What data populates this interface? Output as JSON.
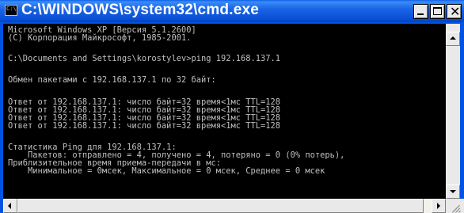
{
  "window": {
    "title": "C:\\WINDOWS\\system32\\cmd.exe",
    "icon": "cmd-icon",
    "icon_text": "C:\\"
  },
  "title_buttons": {
    "minimize_icon": "minimize-icon",
    "maximize_icon": "maximize-icon",
    "close_icon": "close-icon",
    "close_glyph": "✕"
  },
  "console": {
    "lines": [
      "Microsoft Windows XP [Версия 5.1.2600]",
      "(С) Корпорация Майкрософт, 1985-2001.",
      "",
      "C:\\Documents and Settings\\korostylev>ping 192.168.137.1",
      "",
      "Обмен пакетами с 192.168.137.1 по 32 байт:",
      "",
      "Ответ от 192.168.137.1: число байт=32 время<1мс TTL=128",
      "Ответ от 192.168.137.1: число байт=32 время<1мс TTL=128",
      "Ответ от 192.168.137.1: число байт=32 время<1мс TTL=128",
      "Ответ от 192.168.137.1: число байт=32 время<1мс TTL=128",
      "",
      "Статистика Ping для 192.168.137.1:",
      "    Пакетов: отправлено = 4, получено = 4, потеряно = 0 (0% потерь),",
      "Приблизительное время приема-передачи в мс:",
      "    Минимальное = 0мсек, Максимальное = 0 мсек, Среднее = 0 мсек"
    ],
    "colors": {
      "background": "#000000",
      "text": "#c0c0c0"
    }
  },
  "colors": {
    "titlebar": "#0a4fd6",
    "title_text": "#ffffff",
    "frame": "#0054e3"
  }
}
